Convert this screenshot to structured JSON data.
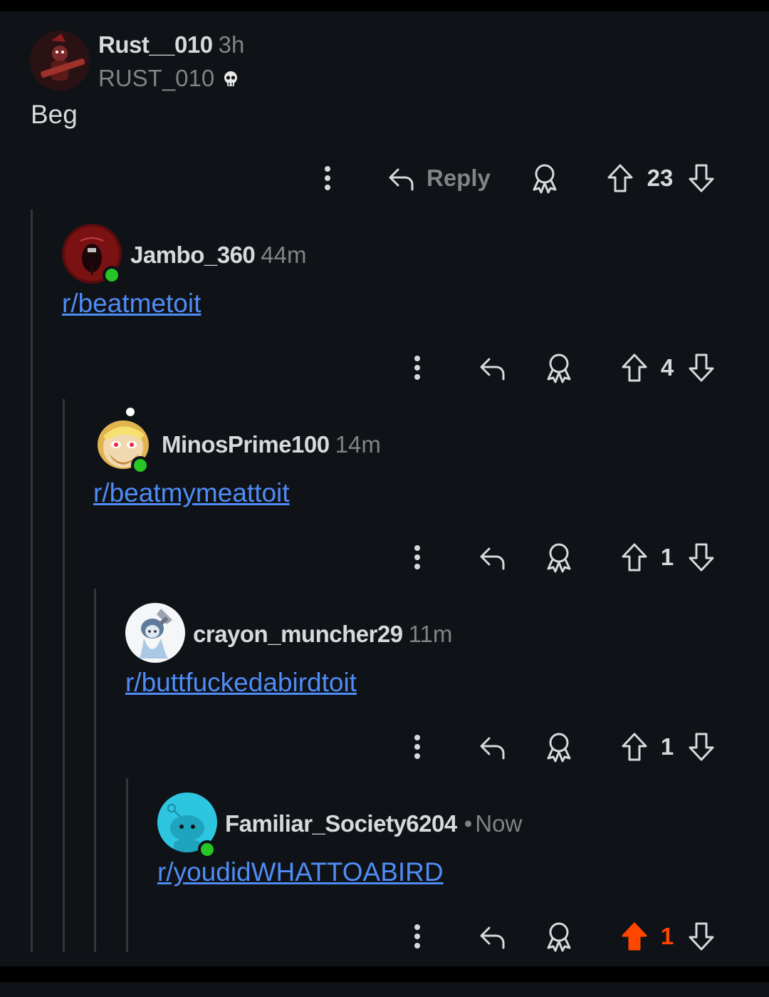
{
  "comments": [
    {
      "username": "Rust__010",
      "time": "3h",
      "flair": "RUST_010",
      "body": "Beg",
      "reply_label": "Reply",
      "votes": "23",
      "upvoted": false,
      "online": false,
      "avatar_color": "#4a1818"
    },
    {
      "username": "Jambo_360",
      "time": "44m",
      "link": "r/beatmetoit",
      "votes": "4",
      "upvoted": false,
      "online": true,
      "avatar_color": "#6b1010"
    },
    {
      "username": "MinosPrime100",
      "time": "14m",
      "link": "r/beatmymeattoit",
      "votes": "1",
      "upvoted": false,
      "online": true,
      "avatar_color": "#e8c46a"
    },
    {
      "username": "crayon_muncher29",
      "time": "11m",
      "link": "r/buttfuckedabirdtoit",
      "votes": "1",
      "upvoted": false,
      "online": false,
      "avatar_color": "#f4f6f8"
    },
    {
      "username": "Familiar_Society6204",
      "separator": "•",
      "time": "Now",
      "link": "r/youdidWHATTOABIRD",
      "votes": "1",
      "upvoted": true,
      "online": true,
      "avatar_color": "#2ec5e0"
    }
  ],
  "colors": {
    "background": "#0f1216",
    "link": "#4f8cf5",
    "upvote_active": "#ff4500",
    "online": "#26c626",
    "muted": "#818384"
  },
  "icons": [
    "more-vertical-icon",
    "reply-icon",
    "award-icon",
    "upvote-icon",
    "downvote-icon",
    "skull-flair-icon"
  ]
}
